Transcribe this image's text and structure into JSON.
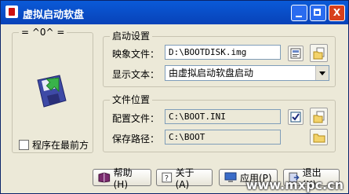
{
  "window": {
    "title": "虚拟启动软盘",
    "controls": {
      "minimize": "",
      "maximize": "",
      "close": "X"
    }
  },
  "left_panel": {
    "group_title": "= ^0^ =",
    "always_on_top_label": "程序在最前方",
    "always_on_top_checked": false
  },
  "boot_settings": {
    "group_title": "启动设置",
    "image_file_label": "映象文件：",
    "image_file_value": "D:\\BOOTDISK.img",
    "display_text_label": "显示文本：",
    "display_text_value": "由虚拟启动软盘启动"
  },
  "file_location": {
    "group_title": "文件位置",
    "config_file_label": "配置文件：",
    "config_file_value": "C:\\BOOT.INI",
    "config_checked": true,
    "save_path_label": "保存路径：",
    "save_path_value": "C:\\BOOT"
  },
  "buttons": {
    "help": "帮助(H)",
    "about": "关于(A)",
    "apply": "应用(P)",
    "exit": "退出(X)"
  },
  "watermark": "www.mxpc.cn",
  "colors": {
    "titlebar": "#0a5ad8",
    "face": "#ece9d8",
    "close_button": "#d8401c"
  }
}
